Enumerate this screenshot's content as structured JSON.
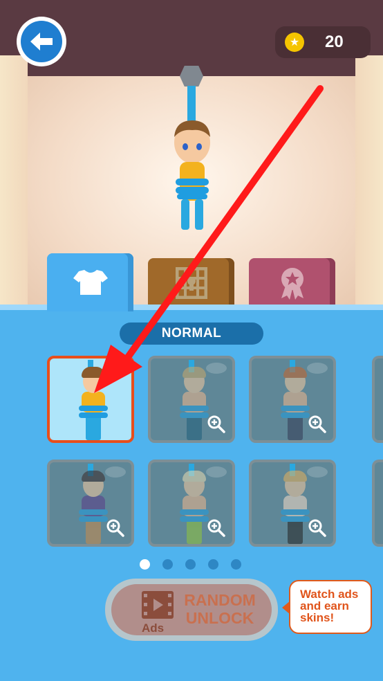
{
  "header": {
    "back_icon": "arrow-left-icon",
    "coin_icon": "coin-star-icon",
    "coin_count": "20"
  },
  "tabs": [
    {
      "icon": "tshirt-icon",
      "active": true
    },
    {
      "icon": "map-puzzle-icon",
      "active": false
    },
    {
      "icon": "award-ribbon-icon",
      "active": false
    }
  ],
  "category_label": "NORMAL",
  "skins": [
    {
      "hair": "#8a5a2b",
      "shirt": "#f3b21e",
      "legs": "#2aa8e0",
      "selected": true,
      "locked": false
    },
    {
      "hair": "#c9a96b",
      "shirt": "#f0b88d",
      "legs": "#1f5f7a",
      "selected": false,
      "locked": true
    },
    {
      "hair": "#c8642a",
      "shirt": "#f0b88d",
      "legs": "#333a55",
      "selected": false,
      "locked": true
    },
    {
      "hair": "#3a2a2a",
      "shirt": "#5a3b8a",
      "legs": "#c98a4a",
      "selected": false,
      "locked": true
    },
    {
      "hair": "#e8dcb2",
      "shirt": "#f0b88d",
      "legs": "#8fc43a",
      "selected": false,
      "locked": true
    },
    {
      "hair": "#e7b25c",
      "shirt": "#f5dcc8",
      "legs": "#222222",
      "selected": false,
      "locked": true
    }
  ],
  "pagination": {
    "pages": 5,
    "current": 0
  },
  "random_button": {
    "line1": "RANDOM",
    "line2": "UNLOCK",
    "ads_label": "Ads",
    "icon": "film-play-icon"
  },
  "tooltip": "Watch ads and earn skins!",
  "colors": {
    "panel": "#4fb3ee",
    "selected_border": "#e84e1b",
    "arrow": "#ff1a1a"
  }
}
